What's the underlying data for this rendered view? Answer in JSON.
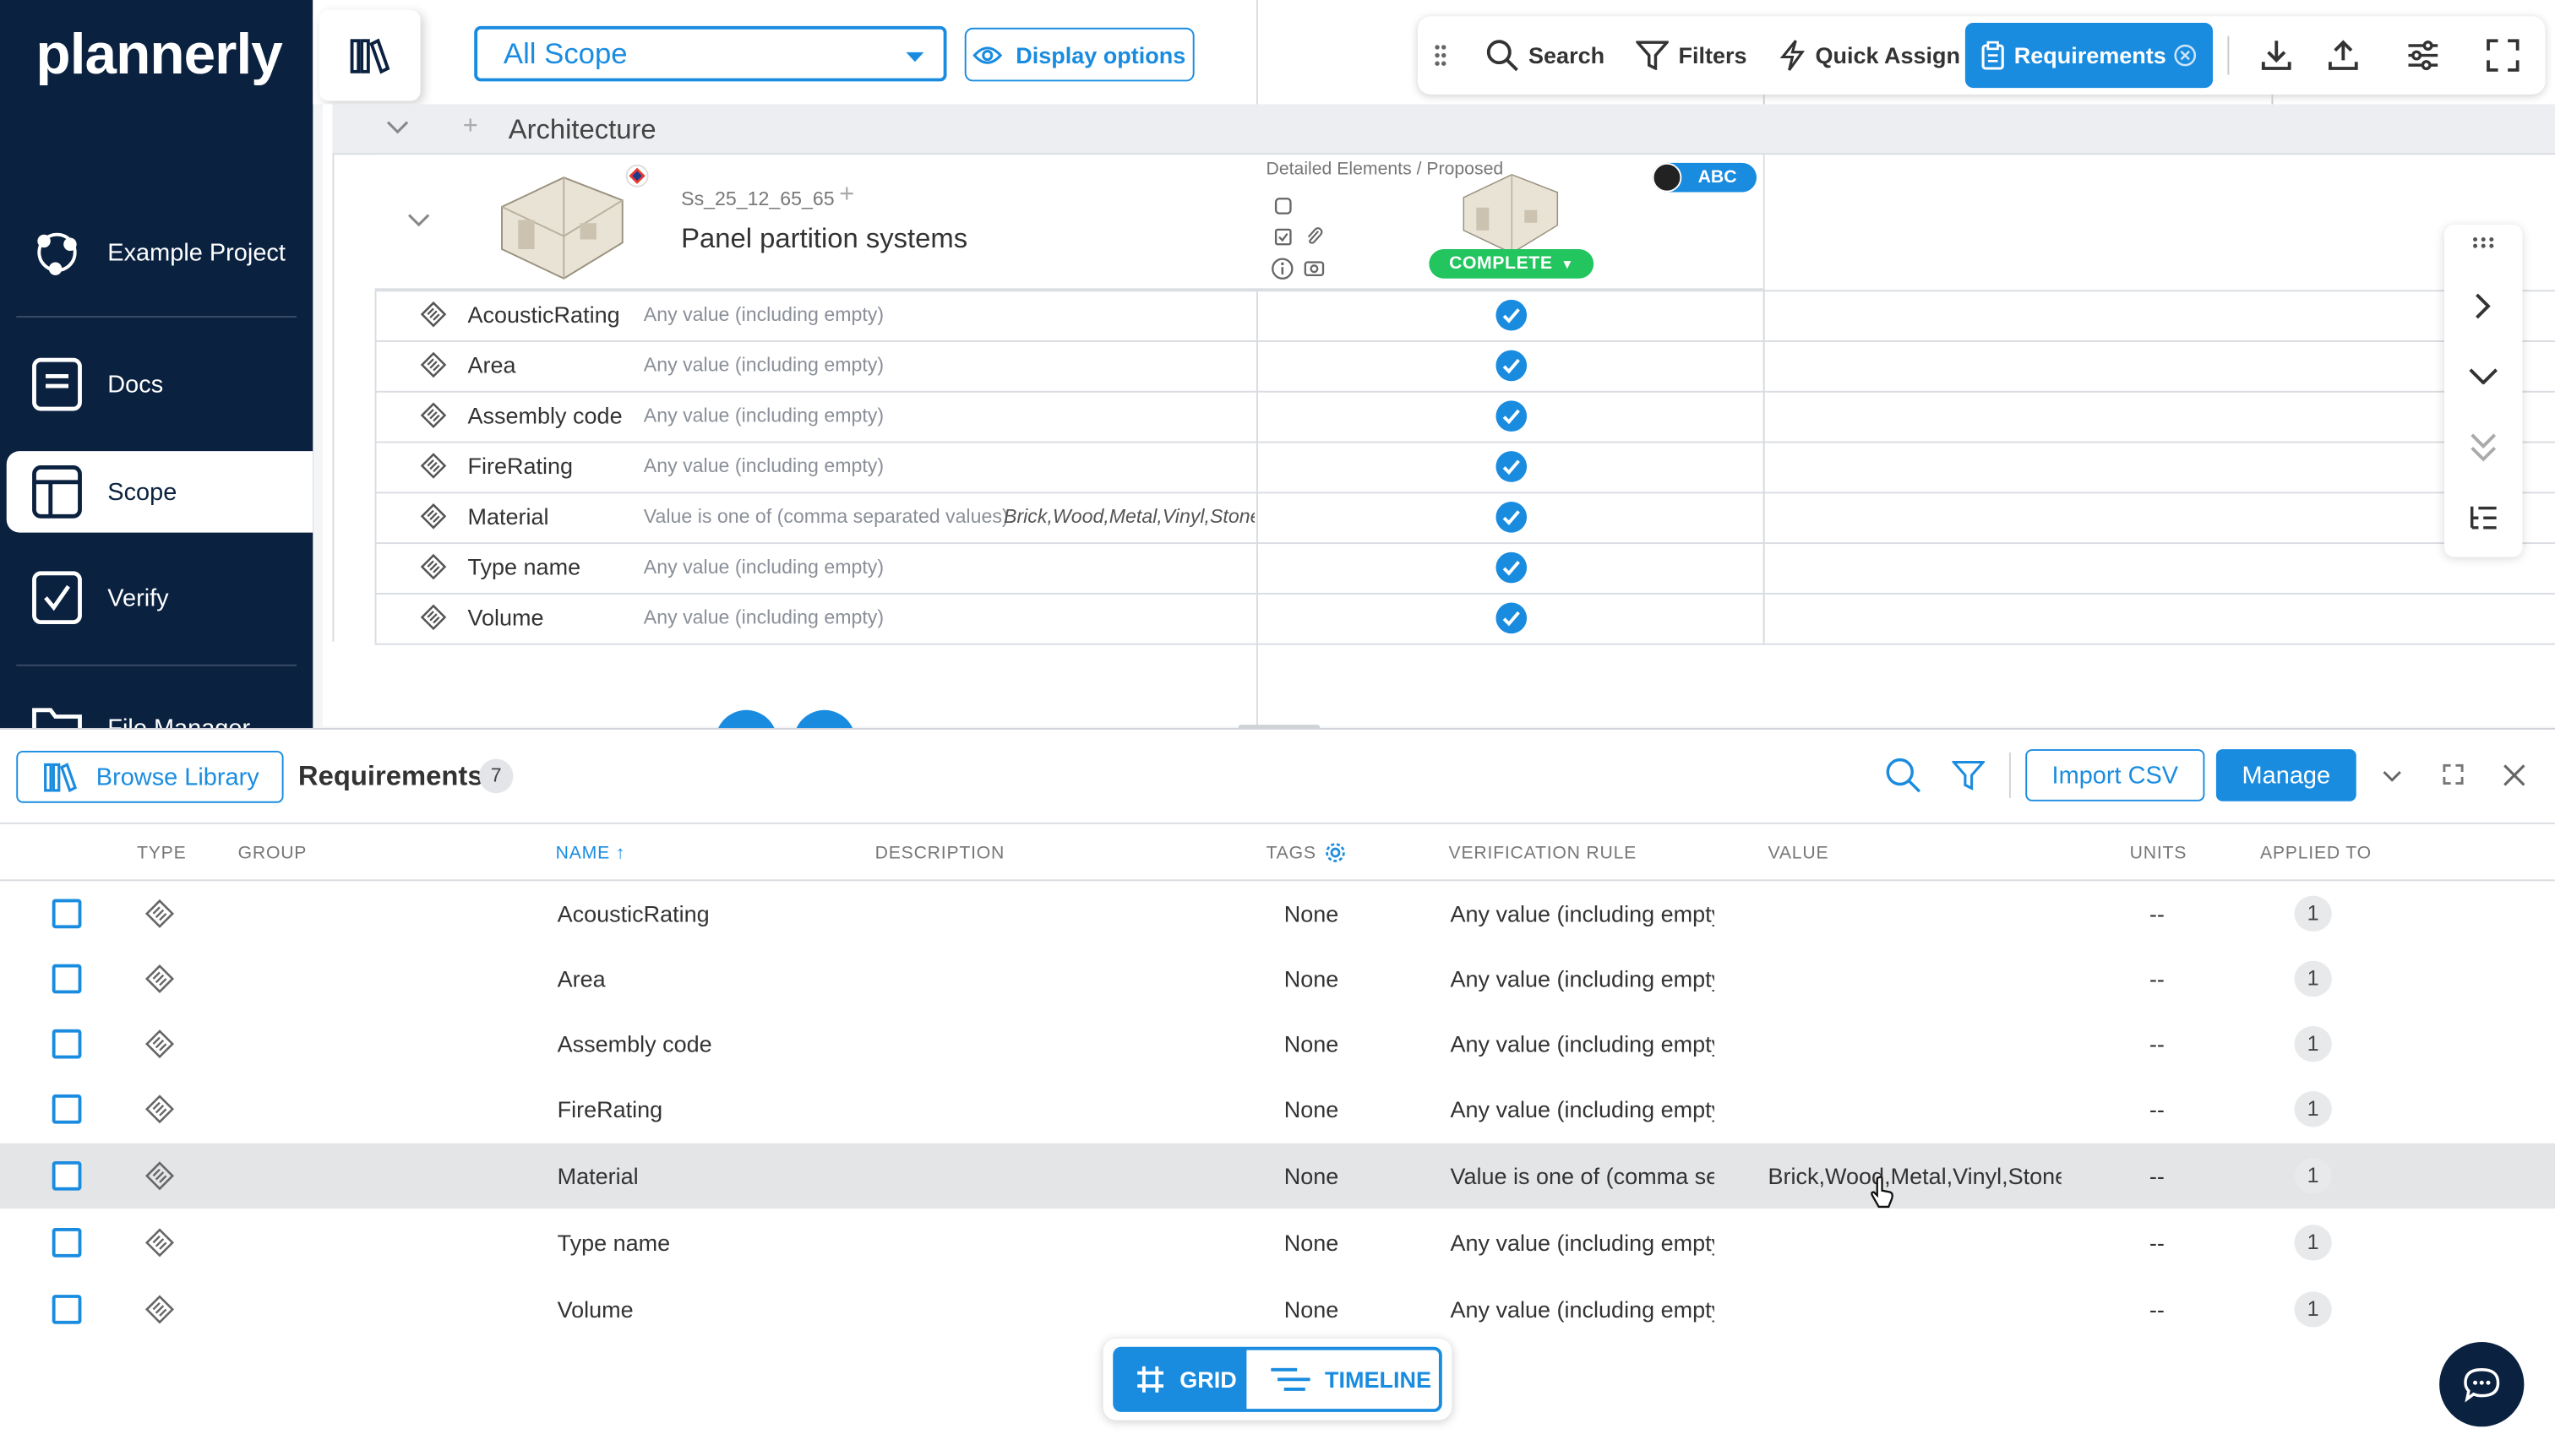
{
  "app": {
    "logo": "plannerly"
  },
  "sidebar": {
    "items": [
      {
        "label": "Example Project",
        "icon": "project-network-icon"
      },
      {
        "label": "Docs",
        "icon": "docs-icon"
      },
      {
        "label": "Scope",
        "icon": "scope-icon",
        "active": true
      },
      {
        "label": "Verify",
        "icon": "verify-check-icon"
      },
      {
        "label": "File Manager",
        "icon": "folder-icon"
      }
    ]
  },
  "topbar": {
    "scope_select": "All Scope",
    "display_options": "Display options",
    "toolbar": {
      "search": "Search",
      "filters": "Filters",
      "quick_assign": "Quick Assign",
      "requirements": "Requirements"
    }
  },
  "grid": {
    "section": "Architecture",
    "element": {
      "code": "Ss_25_12_65_65",
      "name": "Panel partition systems"
    },
    "column_header": "Detailed Elements / Proposed",
    "assignee": "ABC",
    "status": "COMPLETE",
    "properties": [
      {
        "name": "AcousticRating",
        "rule": "Any value (including empty)",
        "value": ""
      },
      {
        "name": "Area",
        "rule": "Any value (including empty)",
        "value": ""
      },
      {
        "name": "Assembly code",
        "rule": "Any value (including empty)",
        "value": ""
      },
      {
        "name": "FireRating",
        "rule": "Any value (including empty)",
        "value": ""
      },
      {
        "name": "Material",
        "rule": "Value is one of (comma separated values)",
        "value": "Brick,Wood,Metal,Vinyl,Stone,C..."
      },
      {
        "name": "Type name",
        "rule": "Any value (including empty)",
        "value": ""
      },
      {
        "name": "Volume",
        "rule": "Any value (including empty)",
        "value": ""
      }
    ]
  },
  "requirements_panel": {
    "browse_library": "Browse Library",
    "title": "Requirements",
    "count": "7",
    "import_csv": "Import CSV",
    "manage": "Manage",
    "columns": {
      "type": "TYPE",
      "group": "GROUP",
      "name": "NAME ↑",
      "description": "DESCRIPTION",
      "tags": "TAGS",
      "verification_rule": "VERIFICATION RULE",
      "value": "VALUE",
      "units": "UNITS",
      "applied_to": "APPLIED TO"
    },
    "rows": [
      {
        "name": "AcousticRating",
        "tags": "None",
        "rule": "Any value (including empty)",
        "value": "",
        "units": "--",
        "applied": "1"
      },
      {
        "name": "Area",
        "tags": "None",
        "rule": "Any value (including empty)",
        "value": "",
        "units": "--",
        "applied": "1"
      },
      {
        "name": "Assembly code",
        "tags": "None",
        "rule": "Any value (including empty)",
        "value": "",
        "units": "--",
        "applied": "1"
      },
      {
        "name": "FireRating",
        "tags": "None",
        "rule": "Any value (including empty)",
        "value": "",
        "units": "--",
        "applied": "1"
      },
      {
        "name": "Material",
        "tags": "None",
        "rule": "Value is one of (comma separated values)",
        "value": "Brick,Wood,Metal,Vinyl,Stone,Concrete",
        "units": "--",
        "applied": "1",
        "highlighted": true
      },
      {
        "name": "Type name",
        "tags": "None",
        "rule": "Any value (including empty)",
        "value": "",
        "units": "--",
        "applied": "1"
      },
      {
        "name": "Volume",
        "tags": "None",
        "rule": "Any value (including empty)",
        "value": "",
        "units": "--",
        "applied": "1"
      }
    ]
  },
  "view_toggle": {
    "grid": "GRID",
    "timeline": "TIMELINE"
  },
  "colors": {
    "brand_navy": "#0b2140",
    "accent_blue": "#1a8ce0",
    "complete_green": "#22c55e"
  }
}
